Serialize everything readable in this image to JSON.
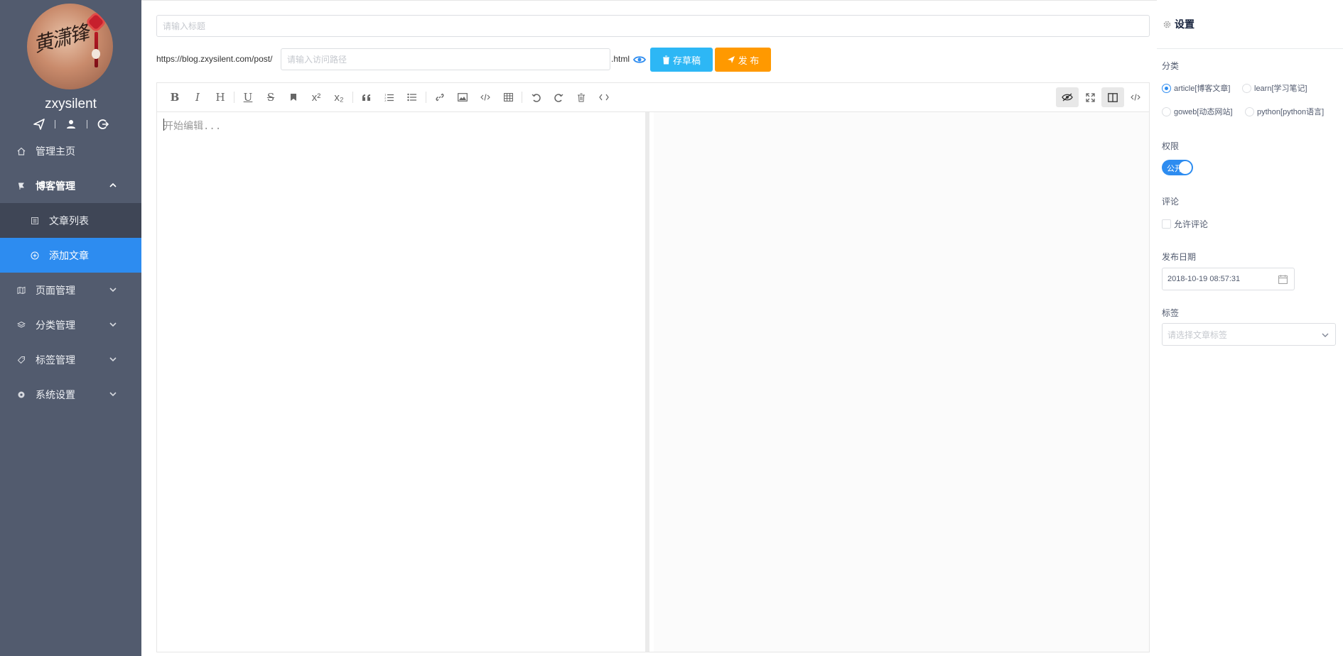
{
  "sidebar": {
    "username": "zxysilent",
    "avatar_signature": "黄潇锋",
    "icons": [
      "send-icon",
      "user-icon",
      "logout-icon"
    ],
    "items": [
      {
        "label": "管理主页",
        "icon": "home-icon"
      },
      {
        "label": "博客管理",
        "icon": "pin-icon",
        "expanded": true
      },
      {
        "label": "文章列表",
        "icon": "list-icon",
        "sub": true
      },
      {
        "label": "添加文章",
        "icon": "plus-circle-icon",
        "sub": true,
        "active": true
      },
      {
        "label": "页面管理",
        "icon": "map-icon"
      },
      {
        "label": "分类管理",
        "icon": "layers-icon"
      },
      {
        "label": "标签管理",
        "icon": "tag-icon"
      },
      {
        "label": "系统设置",
        "icon": "gear-icon"
      }
    ]
  },
  "editor": {
    "title_placeholder": "请输入标题",
    "url_prefix": "https://blog.zxysilent.com/post/",
    "path_placeholder": "请输入访问路径",
    "url_suffix": ".html",
    "draft_button": "存草稿",
    "publish_button": "发 布",
    "content_placeholder": "开始编辑...",
    "toolbar": [
      "bold",
      "italic",
      "heading",
      "underline",
      "strikethrough",
      "mark",
      "superscript",
      "subscript",
      "quote",
      "ordered-list",
      "unordered-list",
      "link",
      "image",
      "code",
      "table",
      "undo",
      "redo",
      "trash",
      "html-code"
    ],
    "toolbar_right": [
      "preview",
      "fullscreen",
      "split",
      "html-view"
    ]
  },
  "settings": {
    "title": "设置",
    "category_label": "分类",
    "categories": [
      {
        "label": "article[博客文章]",
        "checked": true
      },
      {
        "label": "learn[学习笔记]",
        "checked": false
      },
      {
        "label": "goweb[动态网站]",
        "checked": false
      },
      {
        "label": "python[python语言]",
        "checked": false
      }
    ],
    "permission_label": "权限",
    "permission_switch_text": "公开",
    "permission_on": true,
    "comment_label": "评论",
    "comment_checkbox": "允许评论",
    "comment_allowed": false,
    "date_label": "发布日期",
    "date_value": "2018-10-19 08:57:31",
    "tags_label": "标签",
    "tags_placeholder": "请选择文章标签"
  },
  "colors": {
    "sidebar_bg": "#525b6e",
    "submenu_bg": "#3f4656",
    "active_blue": "#2d8cf0",
    "draft_btn": "#2db7f5",
    "publish_btn": "#ff9900"
  }
}
